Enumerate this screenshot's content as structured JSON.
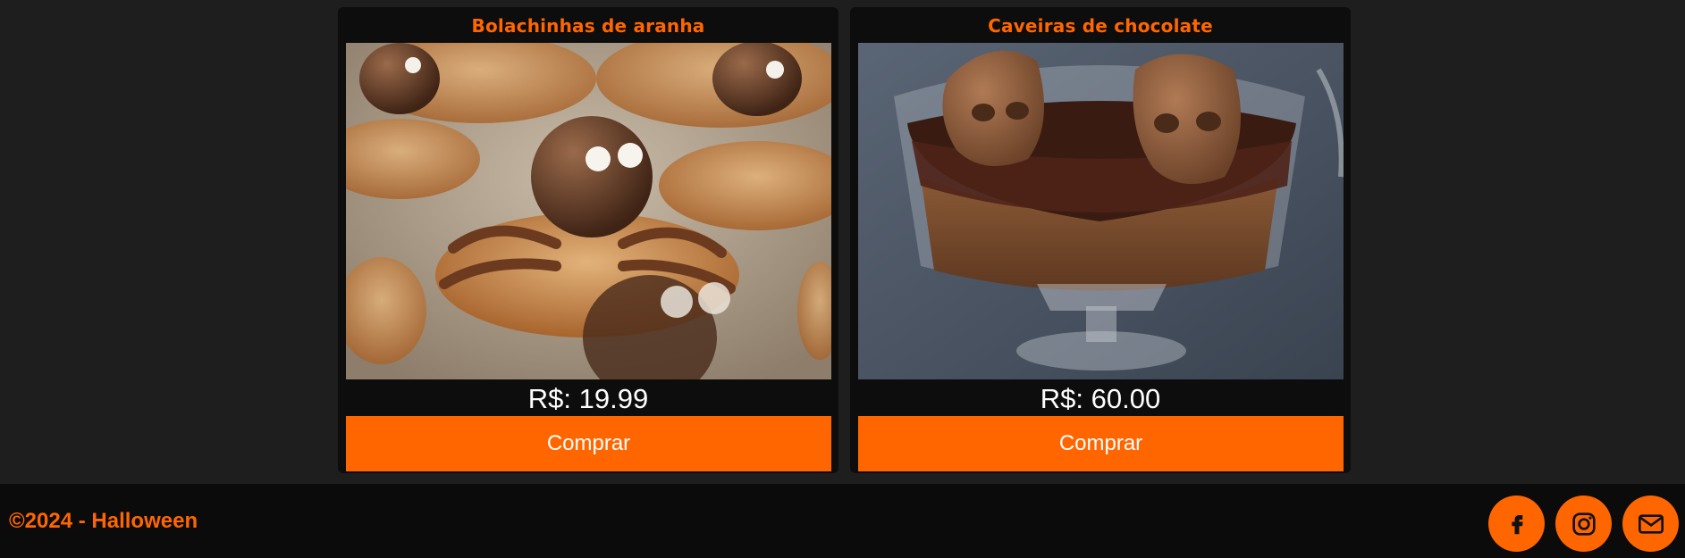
{
  "products": [
    {
      "title": "Bolachinhas de aranha",
      "image": "spider-cookies-photo",
      "price": "R$: 19.99",
      "button_label": "Comprar"
    },
    {
      "title": "Caveiras de chocolate",
      "image": "chocolate-skulls-photo",
      "price": "R$: 60.00",
      "button_label": "Comprar"
    }
  ],
  "footer": {
    "copyright": "©2024 - Halloween",
    "social": [
      {
        "icon": "facebook-icon"
      },
      {
        "icon": "instagram-icon"
      },
      {
        "icon": "mail-icon"
      }
    ]
  },
  "colors": {
    "accent": "#ff6600",
    "page_background": "#1e1e1e",
    "card_background": "#0d0d0d",
    "footer_background": "#0b0b0b",
    "text_light": "#ffffff"
  }
}
